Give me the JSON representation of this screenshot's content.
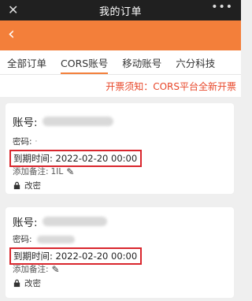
{
  "titlebar": {
    "title": "我的订单"
  },
  "tabs": [
    "全部订单",
    "CORS账号",
    "移动账号",
    "六分科技"
  ],
  "notice": "开票须知：CORS平台全新开票",
  "cards": [
    {
      "account_label": "账号:",
      "password_label": "密码:",
      "password_extra": "·",
      "expiry_label": "到期时间:",
      "expiry_value": "2022-02-20 00:00",
      "note_label": "添加备注:",
      "note_value": "1IL",
      "change_pwd": "改密"
    },
    {
      "account_label": "账号:",
      "password_label": "密码:",
      "expiry_label": "到期时间:",
      "expiry_value": "2022-02-20 00:00",
      "note_label": "添加备注:",
      "change_pwd": "改密"
    }
  ],
  "colors": {
    "accent": "#f37f3a",
    "highlight_box": "#d9262d",
    "notice_text": "#e8472a"
  },
  "icons": [
    "close-icon",
    "more-icon",
    "back-icon",
    "edit-icon",
    "lock-icon"
  ]
}
